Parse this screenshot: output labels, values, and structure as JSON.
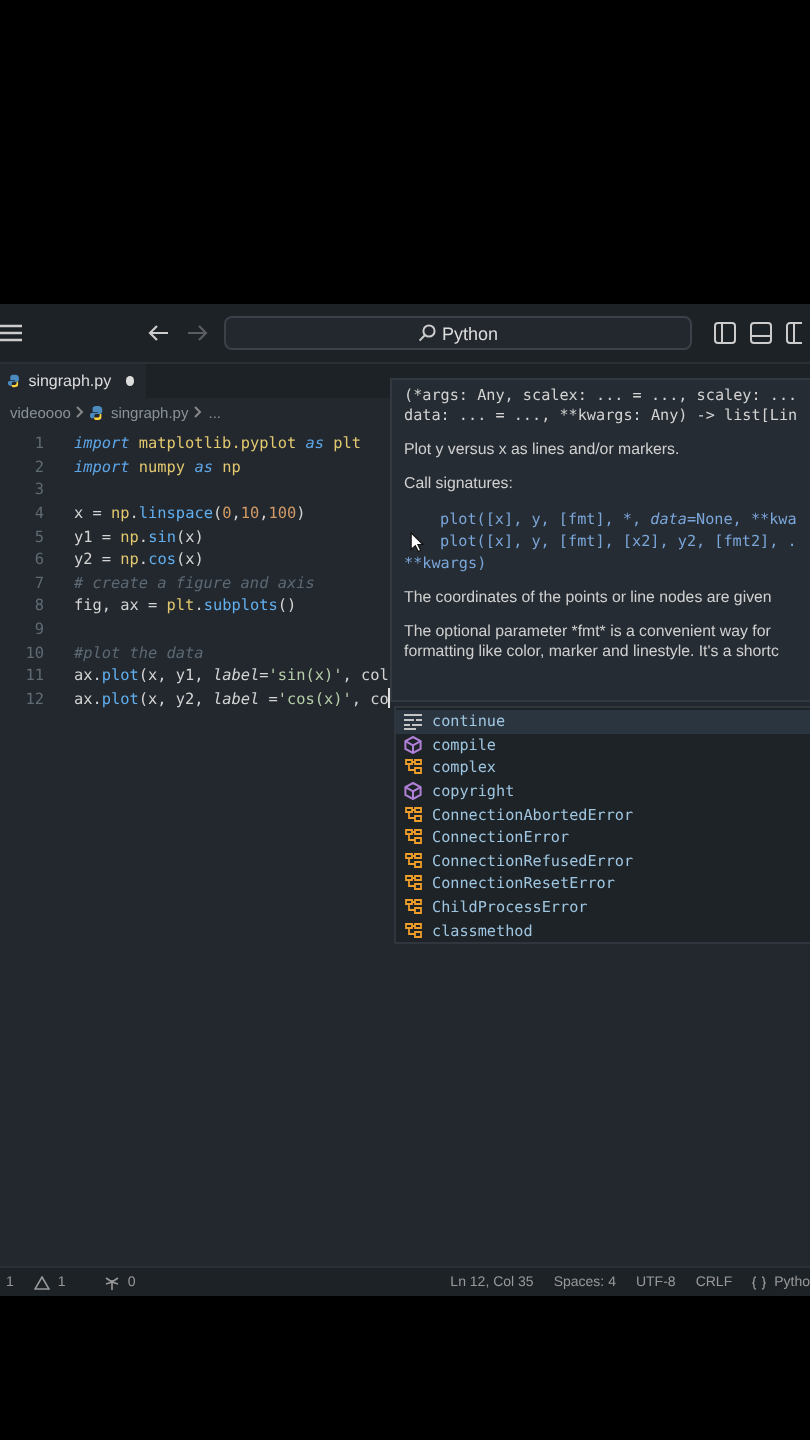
{
  "title_bar": {
    "search": {
      "label": "Python"
    },
    "forward_disabled": true
  },
  "tab": {
    "label": "singraph.py",
    "modified": true
  },
  "breadcrumbs": [
    "videoooo",
    "singraph.py",
    "..."
  ],
  "code_lines": [
    {
      "number": "1",
      "tokens": [
        {
          "t": "import ",
          "kind": "kw"
        },
        {
          "t": "matplotlib.pyplot ",
          "kind": "mod"
        },
        {
          "t": "as ",
          "kind": "kw"
        },
        {
          "t": "plt",
          "kind": "mod"
        }
      ]
    },
    {
      "number": "2",
      "tokens": [
        {
          "t": "import ",
          "kind": "kw"
        },
        {
          "t": "numpy ",
          "kind": "mod"
        },
        {
          "t": "as ",
          "kind": "kw"
        },
        {
          "t": "np",
          "kind": "mod"
        }
      ]
    },
    {
      "number": "3"
    },
    {
      "number": "4",
      "tokens": [
        {
          "t": "x = ",
          "kind": "plain"
        },
        {
          "t": "np",
          "kind": "mod"
        },
        {
          "t": ".",
          "kind": "plain"
        },
        {
          "t": "linspace",
          "kind": "fn"
        },
        {
          "t": "(",
          "kind": "plain"
        },
        {
          "t": "0",
          "kind": "num"
        },
        {
          "t": ",",
          "kind": "plain"
        },
        {
          "t": "10",
          "kind": "num"
        },
        {
          "t": ",",
          "kind": "plain"
        },
        {
          "t": "100",
          "kind": "num"
        },
        {
          "t": ")",
          "kind": "plain"
        }
      ]
    },
    {
      "number": "5",
      "tokens": [
        {
          "t": "y1 = ",
          "kind": "plain"
        },
        {
          "t": "np",
          "kind": "mod"
        },
        {
          "t": ".",
          "kind": "plain"
        },
        {
          "t": "sin",
          "kind": "fn"
        },
        {
          "t": "(x)",
          "kind": "plain"
        }
      ]
    },
    {
      "number": "6",
      "tokens": [
        {
          "t": "y2 = ",
          "kind": "plain"
        },
        {
          "t": "np",
          "kind": "mod"
        },
        {
          "t": ".",
          "kind": "plain"
        },
        {
          "t": "cos",
          "kind": "fn"
        },
        {
          "t": "(x)",
          "kind": "plain"
        }
      ]
    },
    {
      "number": "7",
      "tokens": [
        {
          "t": "# create a figure and axis",
          "kind": "comment"
        }
      ]
    },
    {
      "number": "8",
      "tokens": [
        {
          "t": "fig, ax = ",
          "kind": "plain"
        },
        {
          "t": "plt",
          "kind": "mod"
        },
        {
          "t": ".",
          "kind": "plain"
        },
        {
          "t": "subplots",
          "kind": "fn"
        },
        {
          "t": "()",
          "kind": "plain"
        }
      ]
    },
    {
      "number": "9"
    },
    {
      "number": "10",
      "tokens": [
        {
          "t": "#plot the data",
          "kind": "comment"
        }
      ]
    },
    {
      "number": "11",
      "tokens": [
        {
          "t": "ax.",
          "kind": "plain"
        },
        {
          "t": "plot",
          "kind": "fn"
        },
        {
          "t": "(x, y1, ",
          "kind": "plain"
        },
        {
          "t": "label",
          "kind": "param"
        },
        {
          "t": "=",
          "kind": "plain"
        },
        {
          "t": "'sin(x)'",
          "kind": "str"
        },
        {
          "t": ", col",
          "kind": "plain"
        }
      ]
    },
    {
      "number": "12",
      "cursor": true,
      "tokens": [
        {
          "t": "ax.",
          "kind": "plain"
        },
        {
          "t": "plot",
          "kind": "fn"
        },
        {
          "t": "(x, y2, ",
          "kind": "plain"
        },
        {
          "t": "label",
          "kind": "param"
        },
        {
          "t": " =",
          "kind": "plain"
        },
        {
          "t": "'cos(x)'",
          "kind": "str"
        },
        {
          "t": ", co",
          "kind": "plain"
        }
      ]
    }
  ],
  "hover": {
    "signature": [
      "(*args: Any, scalex: ... = ..., scaley: ...",
      "data: ... = ..., **kwargs: Any) -> list[Lin"
    ],
    "summary": "Plot y versus x as lines and/or markers.",
    "call_heading": "Call signatures:",
    "call_signatures": [
      "plot([x], y, [fmt], *, *data*=None, **kwa",
      "plot([x], y, [fmt], [x2], y2, [fmt2], ."
    ],
    "call_tail": "**kwargs)",
    "paragraphs": [
      "The coordinates of the points or line nodes are given",
      "The optional parameter *fmt* is a convenient way for",
      "formatting like color, marker and linestyle. It's a shortc"
    ]
  },
  "completions": [
    {
      "label": "continue",
      "kind": "keyword",
      "selected": true
    },
    {
      "label": "compile",
      "kind": "function",
      "selected": false
    },
    {
      "label": "complex",
      "kind": "class",
      "selected": false
    },
    {
      "label": "copyright",
      "kind": "function",
      "selected": false
    },
    {
      "label": "ConnectionAbortedError",
      "kind": "class",
      "selected": false
    },
    {
      "label": "ConnectionError",
      "kind": "class",
      "selected": false
    },
    {
      "label": "ConnectionRefusedError",
      "kind": "class",
      "selected": false
    },
    {
      "label": "ConnectionResetError",
      "kind": "class",
      "selected": false
    },
    {
      "label": "ChildProcessError",
      "kind": "class",
      "selected": false
    },
    {
      "label": "classmethod",
      "kind": "class",
      "selected": false
    }
  ],
  "status_bar": {
    "errors": "1",
    "warnings": "1",
    "ports": "0",
    "position": "Ln 12, Col 35",
    "indent": "Spaces: 4",
    "encoding": "UTF-8",
    "eol": "CRLF",
    "language": "Pytho"
  }
}
